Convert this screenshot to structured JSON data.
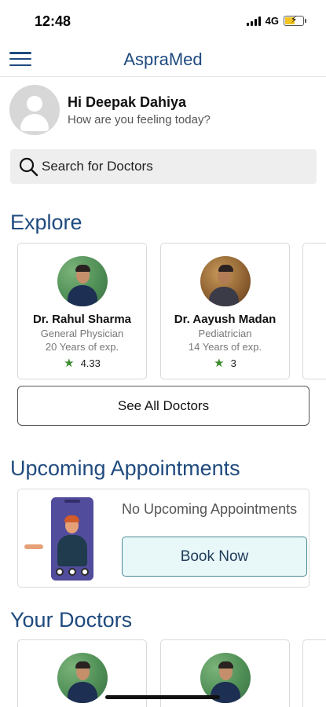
{
  "status": {
    "time": "12:48",
    "network": "4G"
  },
  "header": {
    "title": "AspraMed"
  },
  "greeting": {
    "name": "Hi Deepak Dahiya",
    "subtitle": "How are you feeling today?"
  },
  "search": {
    "placeholder": "Search for Doctors"
  },
  "explore": {
    "title": "Explore",
    "doctors": [
      {
        "name": "Dr. Rahul Sharma",
        "specialty": "General Physician",
        "experience": "20 Years of exp.",
        "rating": "4.33"
      },
      {
        "name": "Dr. Aayush Madan",
        "specialty": "Pediatrician",
        "experience": "14 Years of exp.",
        "rating": "3"
      }
    ],
    "see_all_label": "See All Doctors"
  },
  "appointments": {
    "title": "Upcoming Appointments",
    "empty_text": "No Upcoming Appointments",
    "book_label": "Book Now"
  },
  "your_doctors": {
    "title": "Your Doctors"
  },
  "icons": {
    "menu": "menu-icon",
    "search": "search-icon",
    "star": "star-icon",
    "avatar": "user-icon",
    "battery": "battery-charging-icon",
    "signal": "signal-icon"
  },
  "colors": {
    "brand": "#1f4a7e",
    "star": "#3c8a2e",
    "book_bg": "#e8f8f9"
  }
}
